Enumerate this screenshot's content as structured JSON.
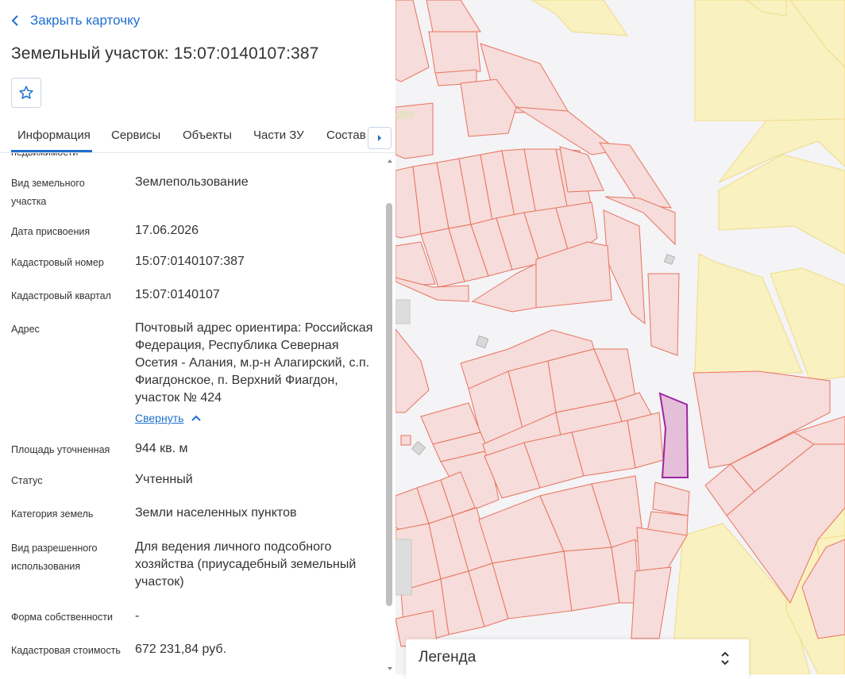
{
  "card": {
    "close_label": "Закрыть карточку",
    "title": "Земельный участок: 15:07:0140107:387"
  },
  "tabs": [
    {
      "label": "Информация"
    },
    {
      "label": "Сервисы"
    },
    {
      "label": "Объекты"
    },
    {
      "label": "Части ЗУ"
    },
    {
      "label": "Состав"
    }
  ],
  "info": {
    "clipped_label": "недвижимости",
    "rows": [
      {
        "label": "Вид земельного участка",
        "value": "Землепользование"
      },
      {
        "label": "Дата присвоения",
        "value": "17.06.2026"
      },
      {
        "label": "Кадастровый номер",
        "value": "15:07:0140107:387"
      },
      {
        "label": "Кадастровый квартал",
        "value": "15:07:0140107"
      },
      {
        "label": "Адрес",
        "value": "Почтовый адрес ориентира: Российская Федерация, Республика Северная Осетия - Алания, м.р-н Алагирский, с.п. Фиагдонское, п. Верхний Фиагдон, участок № 424"
      },
      {
        "label": "Площадь уточненная",
        "value": "944 кв. м"
      },
      {
        "label": "Статус",
        "value": "Учтенный"
      },
      {
        "label": "Категория земель",
        "value": "Земли населенных пунктов"
      },
      {
        "label": "Вид разрешенного использования",
        "value": "Для ведения личного подсобного хозяйства (приусадебный земельный участок)"
      },
      {
        "label": "Форма собственности",
        "value": "-"
      },
      {
        "label": "Кадастровая стоимость",
        "value": "672 231,84 руб."
      }
    ],
    "collapse_label": "Свернуть"
  },
  "map": {
    "legend_label": "Легенда",
    "colors": {
      "parcel_fill": "#f6dcda",
      "parcel_stroke": "#e8735e",
      "zone_fill": "#f9f1bf",
      "zone_stroke": "#eedc88",
      "selected_fill": "#e5bfd9",
      "selected_stroke": "#9c27a0",
      "background": "#f4f3f6"
    }
  },
  "icons": [
    "chevron-left-icon",
    "star-icon",
    "chevron-right-icon",
    "chevron-up-icon",
    "expand-collapse-icon"
  ]
}
